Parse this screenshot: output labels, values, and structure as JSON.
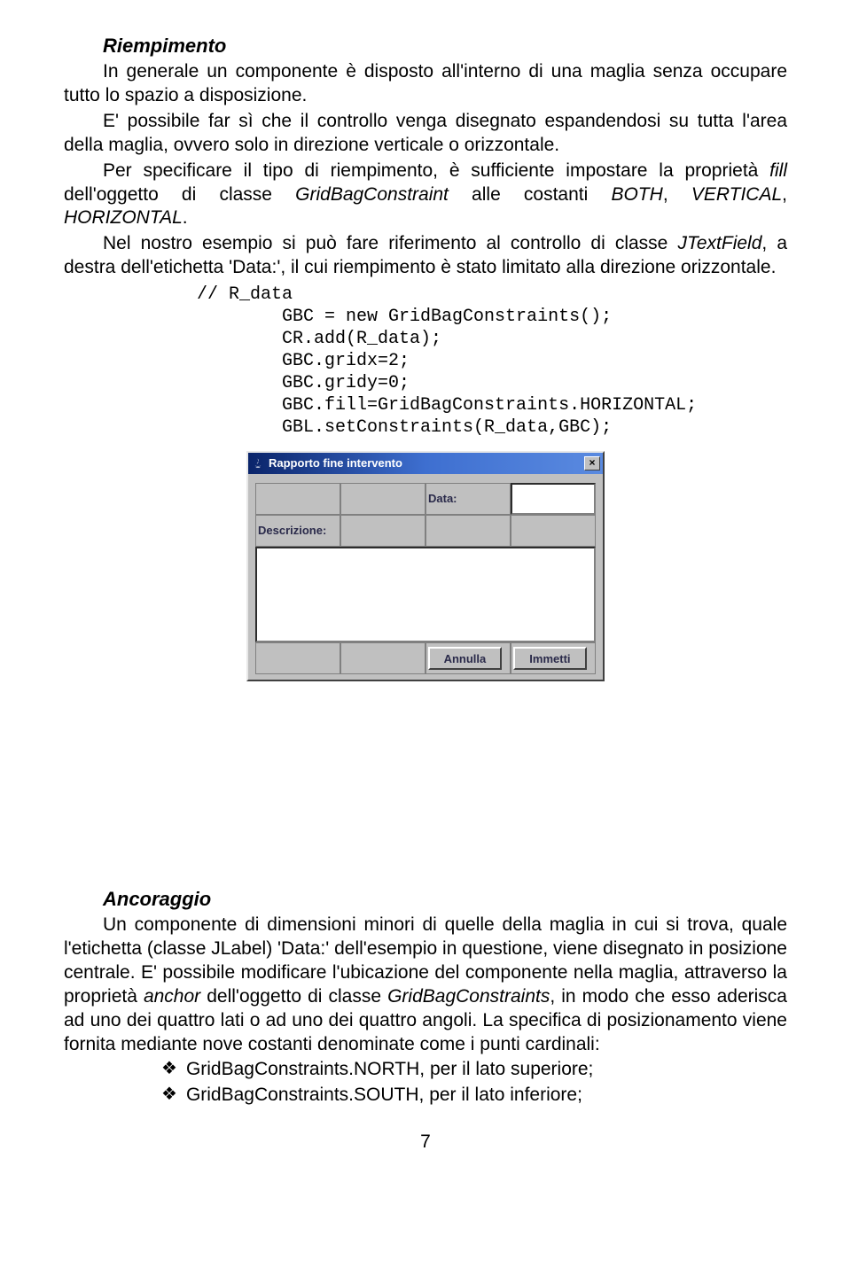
{
  "section1": {
    "heading": "Riempimento",
    "p1a": "In generale un componente è disposto all'interno di una maglia senza occupare tutto lo spazio a disposizione.",
    "p1b": "E' possibile far sì che il controllo venga disegnato espandendosi su tutta l'area della maglia, ovvero solo in direzione verticale o orizzontale.",
    "p2_before_fill": "Per specificare il tipo di riempimento, è sufficiente impostare la proprietà ",
    "fill_word": "fill",
    "p2_mid": " dell'oggetto di classe ",
    "class1": "GridBagConstraint",
    "p2_after": " alle costanti ",
    "const1": "BOTH",
    "comma1": ", ",
    "const2": "VERTICAL",
    "comma2": ", ",
    "const3": "HORIZONTAL",
    "dot1": ".",
    "p3_a": "Nel nostro esempio si può fare riferimento al controllo di classe ",
    "class2": "JTextField",
    "p3_b": ", a destra dell'etichetta 'Data:', il cui riempimento è stato limitato alla direzione orizzontale."
  },
  "code": {
    "l1": "// R_data",
    "l2": "        GBC = new GridBagConstraints();",
    "l3": "        CR.add(R_data);",
    "l4": "        GBC.gridx=2;",
    "l5": "        GBC.gridy=0;",
    "l6": "        GBC.fill=GridBagConstraints.HORIZONTAL;",
    "l7": "        GBL.setConstraints(R_data,GBC);"
  },
  "window": {
    "title": "Rapporto fine intervento",
    "close": "×",
    "label_data": "Data:",
    "label_descrizione": "Descrizione:",
    "btn_annulla": "Annulla",
    "btn_immetti": "Immetti"
  },
  "section2": {
    "heading": "Ancoraggio",
    "p1_a": "Un componente di dimensioni minori di quelle della maglia in cui si trova, quale l'etichetta (classe JLabel) 'Data:' dell'esempio in questione, viene disegnato in posizione centrale. E' possibile modificare l'ubicazione del componente nella maglia, attraverso la proprietà ",
    "anchor_word": "anchor",
    "p1_b": " dell'oggetto di classe ",
    "class3": "GridBagConstraints",
    "p1_c": ", in modo che esso aderisca ad uno dei quattro lati o ad uno dei quattro angoli. La specifica di posizionamento viene fornita mediante nove costanti denominate come i punti cardinali:",
    "bullet_sym": "❖",
    "b1": "GridBagConstraints.NORTH, per il lato superiore;",
    "b2": "GridBagConstraints.SOUTH, per il lato inferiore;"
  },
  "page_number": "7"
}
